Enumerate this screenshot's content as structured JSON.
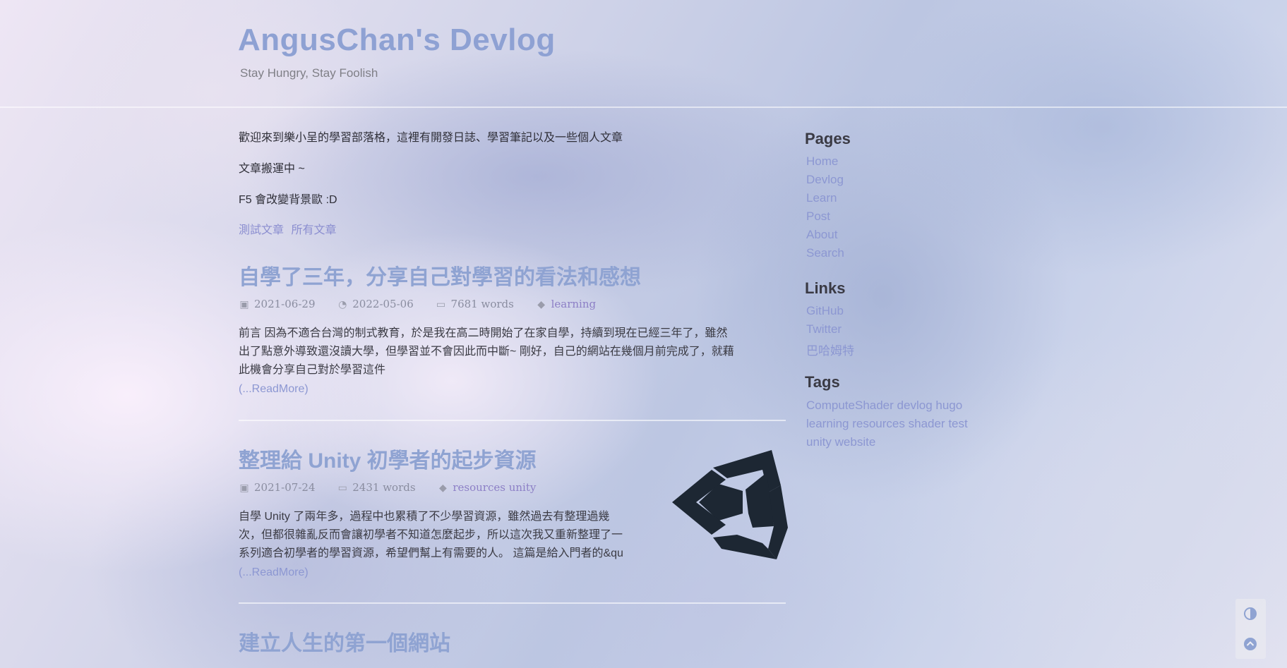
{
  "header": {
    "title": "AngusChan's Devlog",
    "subtitle": "Stay Hungry, Stay Foolish"
  },
  "intro": {
    "line1": "歡迎來到樂小呈的學習部落格，這裡有開發日誌、學習筆記以及一些個人文章",
    "line2": "文章搬運中 ~",
    "line3": "F5 會改變背景歐 :D",
    "links": [
      "測試文章",
      "所有文章"
    ]
  },
  "posts": [
    {
      "title": "自學了三年，分享自己對學習的看法和感想",
      "date": "2021-06-29",
      "updated": "2022-05-06",
      "words": "7681 words",
      "tags": "learning",
      "summary_lines": [
        "前言 因為不適合台灣的制式教育，於是我在高二時開始了在家自學，持續到現在已經三年了，雖然",
        "出了點意外導致還沒讀大學，但學習並不會因此而中斷~ 剛好，自己的網站在幾個月前完成了，就藉",
        "此機會分享自己對於學習這件"
      ],
      "readmore": "(...ReadMore)"
    },
    {
      "title": "整理給 Unity 初學者的起步資源",
      "date": "2021-07-24",
      "words": "2431 words",
      "tags": "resources unity",
      "summary_lines": [
        "自學 Unity 了兩年多，過程中也累積了不少學習資源，雖然過去有整理過幾",
        "次，但都很雜亂反而會讓初學者不知道怎麼起步，所以這次我又重新整理了一",
        "系列適合初學者的學習資源，希望們幫上有需要的人。 這篇是給入門者的&qu"
      ],
      "readmore": "(...ReadMore)",
      "thumbnail": "unity-logo"
    },
    {
      "title": "建立人生的第一個網站"
    }
  ],
  "sidebar": {
    "pages_heading": "Pages",
    "pages": [
      "Home",
      "Devlog",
      "Learn",
      "Post",
      "About",
      "Search"
    ],
    "links_heading": "Links",
    "links": [
      "GitHub",
      "Twitter",
      "巴哈姆特"
    ],
    "tags_heading": "Tags",
    "tags": [
      "ComputeShader",
      "devlog",
      "hugo",
      "learning",
      "resources",
      "shader",
      "test",
      "unity",
      "website"
    ]
  },
  "floating": {
    "theme_icon": "contrast-icon",
    "top_icon": "arrow-up-icon"
  },
  "colors": {
    "accent": "#8ea1d3",
    "link": "#8c97d2",
    "tag": "#8c7fc6"
  }
}
